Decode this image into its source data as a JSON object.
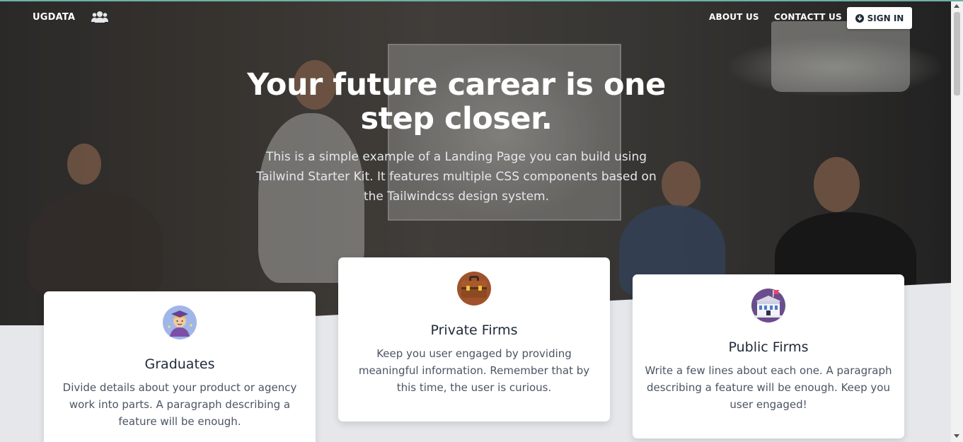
{
  "nav": {
    "brand": "UGDATA",
    "brand_icon": "users-icon",
    "links": [
      "ABOUT US",
      "CONTACTT US"
    ],
    "signin_label": "SIGN IN",
    "signin_icon": "arrow-circle-down-icon"
  },
  "hero": {
    "title": "Your future carear is one step closer.",
    "subtitle": "This is a simple example of a Landing Page you can build using Tailwind Starter Kit. It features multiple CSS components based on the Tailwindcss design system."
  },
  "cards": [
    {
      "title": "Graduates",
      "text": "Divide details about your product or agency work into parts. A paragraph describing a feature will be enough.",
      "icon": "graduate-icon"
    },
    {
      "title": "Private Firms",
      "text": "Keep you user engaged by providing meaningful information. Remember that by this time, the user is curious.",
      "icon": "briefcase-icon"
    },
    {
      "title": "Public Firms",
      "text": "Write a few lines about each one. A paragraph describing a feature will be enough. Keep you user engaged!",
      "icon": "building-icon"
    }
  ],
  "colors": {
    "accent_bar": "#6fb0a8",
    "page_background": "#e5e7eb"
  }
}
